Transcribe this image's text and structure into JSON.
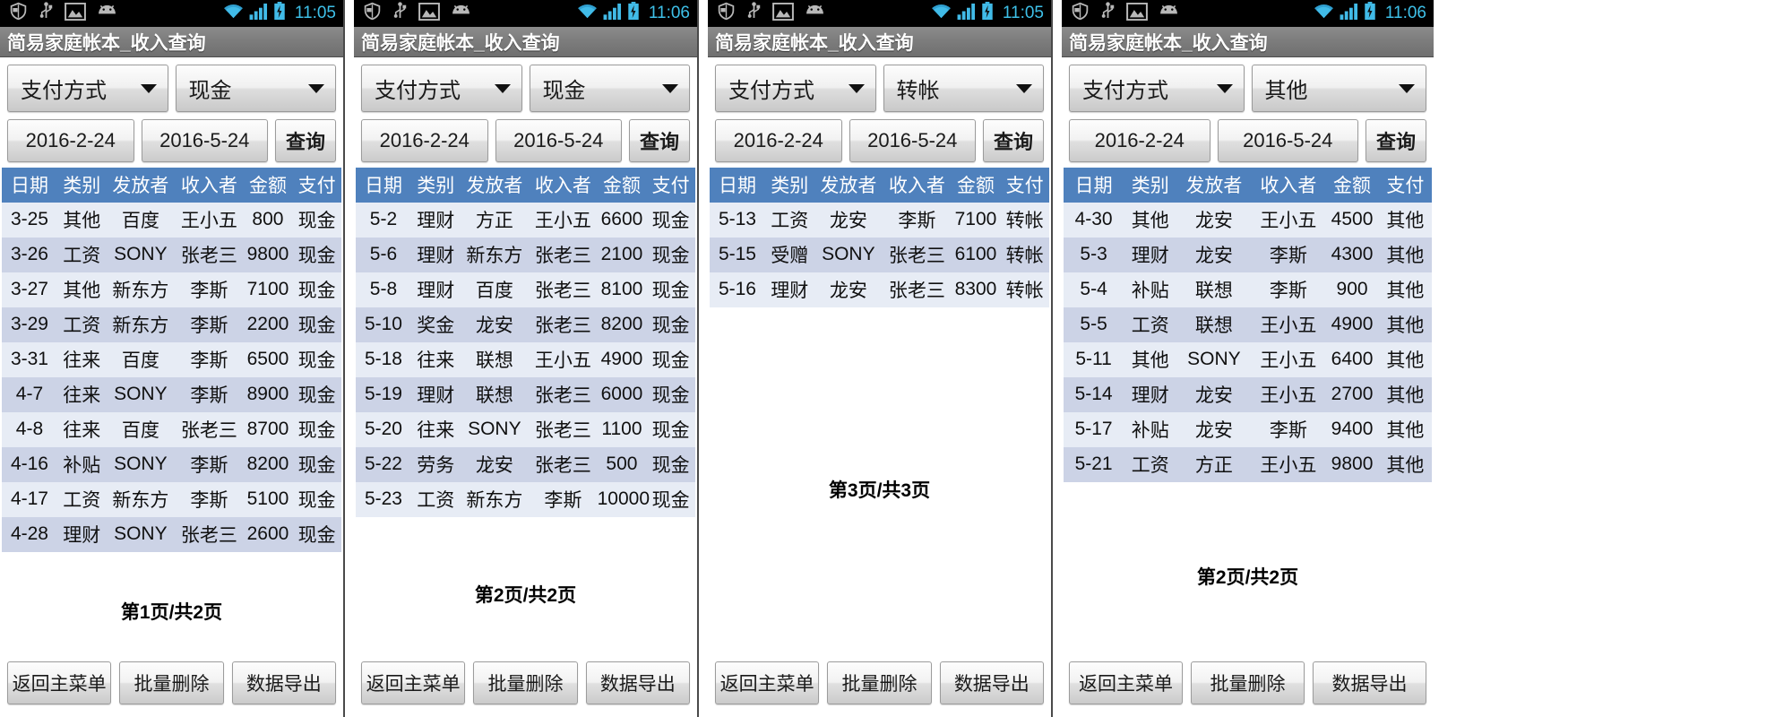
{
  "app": {
    "title": "简易家庭帐本_收入查询",
    "spinner_label": "支付方式",
    "date_from": "2016-2-24",
    "date_to": "2016-5-24",
    "query_label": "查询",
    "columns": [
      "日期",
      "类别",
      "发放者",
      "收入者",
      "金额",
      "支付"
    ],
    "bottom_buttons": [
      "返回主菜单",
      "批量删除",
      "数据导出"
    ],
    "status_icons": [
      "shield-icon",
      "usb-icon",
      "image-icon",
      "android-icon",
      "wifi-icon",
      "signal-icon",
      "battery-charging-icon"
    ]
  },
  "panels": [
    {
      "clock": "11:05",
      "payment_filter": "现金",
      "page_text": "第1页/共2页",
      "rows": [
        [
          "3-25",
          "其他",
          "百度",
          "王小五",
          "800",
          "现金"
        ],
        [
          "3-26",
          "工资",
          "SONY",
          "张老三",
          "9800",
          "现金"
        ],
        [
          "3-27",
          "其他",
          "新东方",
          "李斯",
          "7100",
          "现金"
        ],
        [
          "3-29",
          "工资",
          "新东方",
          "李斯",
          "2200",
          "现金"
        ],
        [
          "3-31",
          "往来",
          "百度",
          "李斯",
          "6500",
          "现金"
        ],
        [
          "4-7",
          "往来",
          "SONY",
          "李斯",
          "8900",
          "现金"
        ],
        [
          "4-8",
          "往来",
          "百度",
          "张老三",
          "8700",
          "现金"
        ],
        [
          "4-16",
          "补贴",
          "SONY",
          "李斯",
          "8200",
          "现金"
        ],
        [
          "4-17",
          "工资",
          "新东方",
          "李斯",
          "5100",
          "现金"
        ],
        [
          "4-28",
          "理财",
          "SONY",
          "张老三",
          "2600",
          "现金"
        ]
      ]
    },
    {
      "clock": "11:06",
      "payment_filter": "现金",
      "page_text": "第2页/共2页",
      "rows": [
        [
          "5-2",
          "理财",
          "方正",
          "王小五",
          "6600",
          "现金"
        ],
        [
          "5-6",
          "理财",
          "新东方",
          "张老三",
          "2100",
          "现金"
        ],
        [
          "5-8",
          "理财",
          "百度",
          "张老三",
          "8100",
          "现金"
        ],
        [
          "5-10",
          "奖金",
          "龙安",
          "张老三",
          "8200",
          "现金"
        ],
        [
          "5-18",
          "往来",
          "联想",
          "王小五",
          "4900",
          "现金"
        ],
        [
          "5-19",
          "理财",
          "联想",
          "张老三",
          "6000",
          "现金"
        ],
        [
          "5-20",
          "往来",
          "SONY",
          "张老三",
          "1100",
          "现金"
        ],
        [
          "5-22",
          "劳务",
          "龙安",
          "张老三",
          "500",
          "现金"
        ],
        [
          "5-23",
          "工资",
          "新东方",
          "李斯",
          "10000",
          "现金"
        ]
      ]
    },
    {
      "clock": "11:05",
      "payment_filter": "转帐",
      "page_text": "第3页/共3页",
      "rows": [
        [
          "5-13",
          "工资",
          "龙安",
          "李斯",
          "7100",
          "转帐"
        ],
        [
          "5-15",
          "受赠",
          "SONY",
          "张老三",
          "6100",
          "转帐"
        ],
        [
          "5-16",
          "理财",
          "龙安",
          "张老三",
          "8300",
          "转帐"
        ]
      ]
    },
    {
      "clock": "11:06",
      "payment_filter": "其他",
      "page_text": "第2页/共2页",
      "rows": [
        [
          "4-30",
          "其他",
          "龙安",
          "王小五",
          "4500",
          "其他"
        ],
        [
          "5-3",
          "理财",
          "龙安",
          "李斯",
          "4300",
          "其他"
        ],
        [
          "5-4",
          "补贴",
          "联想",
          "李斯",
          "900",
          "其他"
        ],
        [
          "5-5",
          "工资",
          "联想",
          "王小五",
          "4900",
          "其他"
        ],
        [
          "5-11",
          "其他",
          "SONY",
          "王小五",
          "6400",
          "其他"
        ],
        [
          "5-14",
          "理财",
          "龙安",
          "王小五",
          "2700",
          "其他"
        ],
        [
          "5-17",
          "补贴",
          "龙安",
          "李斯",
          "9400",
          "其他"
        ],
        [
          "5-21",
          "工资",
          "方正",
          "王小五",
          "9800",
          "其他"
        ]
      ]
    }
  ],
  "colors": {
    "header_blue": "#4f81bd",
    "row_odd": "#e7ecf5",
    "row_even": "#ccd3e6",
    "statusbar_bg": "#000000",
    "clock": "#3ec0e8",
    "titlebar": "#7d7d7d"
  }
}
